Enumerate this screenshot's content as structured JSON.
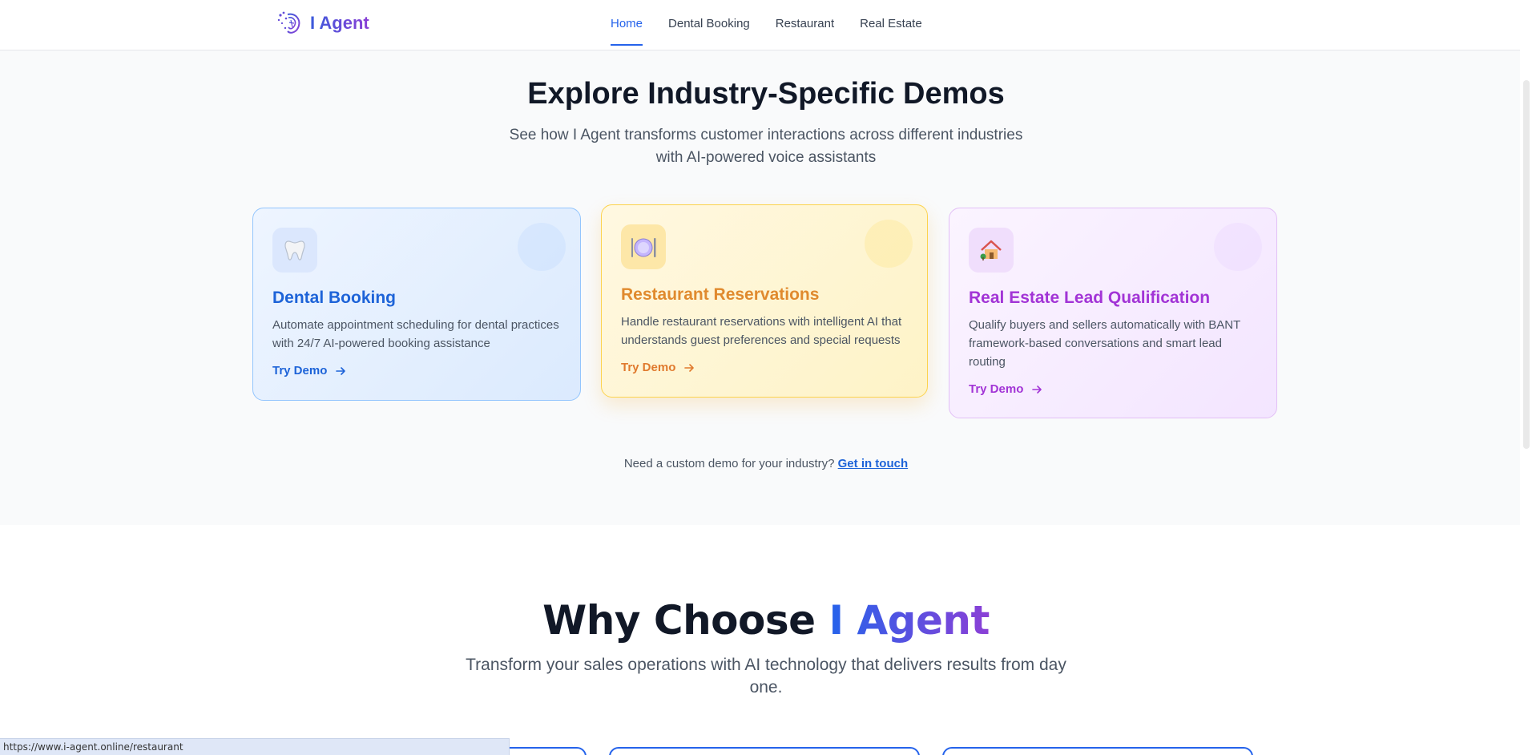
{
  "header": {
    "logo_text": "I Agent",
    "nav": [
      {
        "label": "Home",
        "active": true
      },
      {
        "label": "Dental Booking",
        "active": false
      },
      {
        "label": "Restaurant",
        "active": false
      },
      {
        "label": "Real Estate",
        "active": false
      }
    ]
  },
  "demos": {
    "title": "Explore Industry-Specific Demos",
    "subtitle": "See how I Agent transforms customer interactions across different industries with AI-powered voice assistants",
    "cards": [
      {
        "icon": "tooth-icon",
        "title": "Dental Booking",
        "description": "Automate appointment scheduling for dental practices with 24/7 AI-powered booking assistance",
        "cta": "Try Demo",
        "color": "#1d63d8"
      },
      {
        "icon": "plate-icon",
        "title": "Restaurant Reservations",
        "description": "Handle restaurant reservations with intelligent AI that understands guest preferences and special requests",
        "cta": "Try Demo",
        "color": "#e08a2e"
      },
      {
        "icon": "house-icon",
        "title": "Real Estate Lead Qualification",
        "description": "Qualify buyers and sellers automatically with BANT framework-based conversations and smart lead routing",
        "cta": "Try Demo",
        "color": "#a234d6"
      }
    ],
    "custom_prompt": "Need a custom demo for your industry?",
    "custom_link": "Get in touch"
  },
  "why": {
    "title_prefix": "Why Choose",
    "title_accent": "I Agent",
    "subtitle": "Transform your sales operations with AI technology that delivers results from day one."
  },
  "status_bar": {
    "url": "https://www.i-agent.online/restaurant"
  }
}
